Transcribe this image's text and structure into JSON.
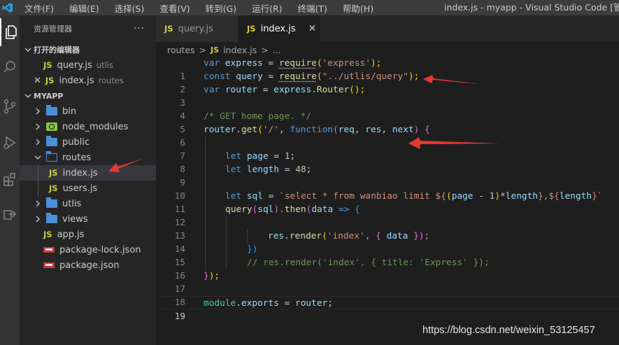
{
  "menu": {
    "items": [
      "文件(F)",
      "编辑(E)",
      "选择(S)",
      "查看(V)",
      "转到(G)",
      "运行(R)",
      "终端(T)",
      "帮助(H)"
    ],
    "window_title": "index.js - myapp - Visual Studio Code [管理员"
  },
  "activity_bar": [
    "explorer-icon",
    "search-icon",
    "source-control-icon",
    "run-debug-icon",
    "extensions-icon",
    "remote-icon"
  ],
  "sidebar": {
    "title": "资源管理器",
    "more": "···",
    "open_editors_title": "打开的编辑器",
    "open_editors": [
      {
        "name": "query.js",
        "desc": "utlis",
        "badge": "JS"
      },
      {
        "name": "index.js",
        "desc": "routes",
        "badge": "JS",
        "close": "✕"
      }
    ],
    "project_title": "MYAPP",
    "tree": {
      "bin": "bin",
      "node_modules": "node_modules",
      "public": "public",
      "routes": "routes",
      "index_js": "index.js",
      "users_js": "users.js",
      "utlis": "utlis",
      "views": "views",
      "app_js": "app.js",
      "package_lock": "package-lock.json",
      "package_json": "package.json",
      "js_badge": "JS"
    }
  },
  "tabs": [
    {
      "label": "query.js",
      "badge": "JS",
      "active": false
    },
    {
      "label": "index.js",
      "badge": "JS",
      "active": true,
      "close": "✕"
    }
  ],
  "breadcrumb": {
    "folder": "routes",
    "sep": ">",
    "file": "index.js",
    "badge": "JS",
    "more": "..."
  },
  "editor": {
    "line_numbers": [
      "1",
      "2",
      "3",
      "4",
      "5",
      "6",
      "7",
      "8",
      "9",
      "10",
      "11",
      "12",
      "13",
      "14",
      "15",
      "16",
      "17",
      "18",
      "19"
    ],
    "current_line": 19,
    "lines": {
      "l1": [
        "var",
        "express",
        "=",
        "require",
        "(",
        "'express'",
        ");"
      ],
      "l2": [
        "const",
        "query",
        "=",
        "require",
        "(",
        "\"../utlis/query\"",
        ");"
      ],
      "l3": [
        "var",
        "router",
        "=",
        "express",
        ".",
        "Router",
        "();"
      ],
      "l5": "/* GET home page. */",
      "l6": [
        "router",
        ".",
        "get",
        "(",
        "'/'",
        ", ",
        "function",
        "(",
        "req",
        ", ",
        "res",
        ", ",
        "next",
        ") ",
        "{"
      ],
      "l8": [
        "let",
        "page",
        "=",
        "1",
        ";"
      ],
      "l9": [
        "let",
        "length",
        "=",
        "48",
        ";"
      ],
      "l11": [
        "let",
        "sql",
        "=",
        "`select * from wanbiao limit ${",
        "(",
        "page",
        " - ",
        "1",
        ")",
        "*",
        "length",
        "},${",
        "length",
        "}`"
      ],
      "l12": [
        "query",
        "(",
        "sql",
        ").",
        "then",
        "(",
        "data",
        " => ",
        "{"
      ],
      "l14": [
        "res",
        ".",
        "render",
        "(",
        "'index'",
        ", { ",
        "data",
        " });"
      ],
      "l15": "})",
      "l16": "// res.render('index', { title: 'Express' });",
      "l17": [
        "}",
        ");"
      ],
      "l19": [
        "module",
        ".",
        "exports",
        " = ",
        "router",
        ";"
      ]
    }
  },
  "watermark": "https://blog.csdn.net/weixin_53125457",
  "colors": {
    "annotation_arrow": "#e53935",
    "js_badge": "#cbcb41",
    "folder": "#4a90d9"
  }
}
